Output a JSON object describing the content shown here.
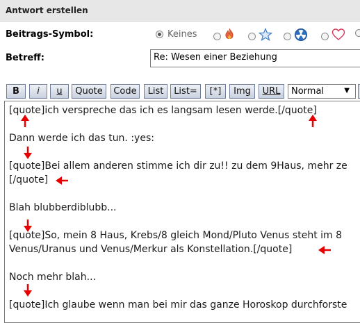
{
  "header": {
    "title": "Antwort erstellen"
  },
  "post_icon": {
    "label": "Beitrags-Symbol:",
    "options": [
      {
        "label": "Keines",
        "selected": true,
        "icon": "none"
      },
      {
        "label": "",
        "selected": false,
        "icon": "flame-icon"
      },
      {
        "label": "",
        "selected": false,
        "icon": "star-icon"
      },
      {
        "label": "",
        "selected": false,
        "icon": "radioactive-icon"
      },
      {
        "label": "",
        "selected": false,
        "icon": "heart-icon"
      },
      {
        "label": "",
        "selected": false,
        "icon": "partial-icon"
      }
    ]
  },
  "subject": {
    "label": "Betreff:",
    "value": "Re: Wesen einer Beziehung"
  },
  "toolbar": {
    "bold": "B",
    "italic": "i",
    "underline": "u",
    "quote": "Quote",
    "code": "Code",
    "list": "List",
    "list_eq": "List=",
    "list_item": "[*]",
    "img": "Img",
    "url": "URL",
    "size_select": "Normal"
  },
  "editor": {
    "lines": [
      "[quote]ich verspreche das ich es langsam lesen werde.[/quote]",
      "Dann werde ich das tun.  :yes:",
      "[quote]Bei allem anderen stimme ich dir zu!! zu dem 9Haus, mehr ze",
      "[/quote]",
      "Blah blubberdiblubb...",
      "[quote]So, mein 8 Haus, Krebs/8 gleich Mond/Pluto Venus steht im 8",
      "Venus/Uranus und Venus/Merkur als Konstellation.[/quote]",
      "Noch mehr blah...",
      "[quote]Ich glaube wenn man bei mir das ganze Horoskop durchforste"
    ]
  },
  "colors": {
    "annotation_arrow": "#e60000",
    "header_bg": "#e7e7e7",
    "button_border": "#6f7d99"
  }
}
